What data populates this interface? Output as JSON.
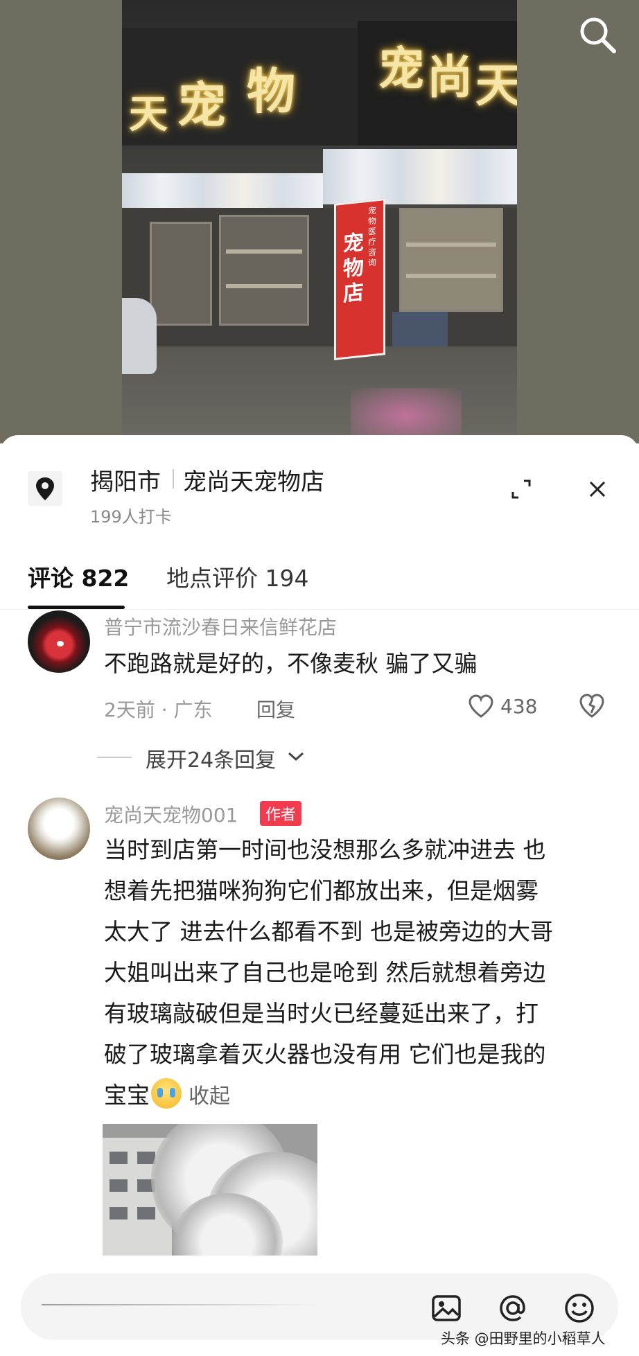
{
  "photo": {
    "sign_left_chars": [
      "天",
      "宠",
      "物"
    ],
    "sign_right_chars": [
      "宠",
      "尚",
      "天"
    ],
    "banner_big": "宠物店",
    "banner_small": "宠物医疗咨询"
  },
  "header": {
    "city": "揭阳市",
    "place_name": "宠尚天宠物店",
    "checkin_count": "199人打卡",
    "icons": [
      "location-pin-icon",
      "expand-icon",
      "close-icon",
      "search-icon"
    ]
  },
  "tabs": [
    {
      "label": "评论 822",
      "active": true
    },
    {
      "label": "地点评价 194",
      "active": false
    }
  ],
  "comments": [
    {
      "user": "普宁市流沙春日来信鲜花店",
      "text": "不跑路就是好的，不像麦秋 骗了又骗",
      "time_location": "2天前 · 广东",
      "reply_label": "回复",
      "likes": "438",
      "expand_replies": "展开24条回复"
    },
    {
      "user": "宠尚天宠物001",
      "badge": "作者",
      "lines": [
        "当时到店第一时间也没想那么多就冲进去 也",
        "想着先把猫咪狗狗它们都放出来，但是烟雾",
        "太大了 进去什么都看不到 也是被旁边的大哥",
        "大姐叫出来了自己也是呛到 然后就想着旁边",
        "有玻璃敲破但是当时火已经蔓延出来了，打",
        "破了玻璃拿着灭火器也没有用 它们也是我的",
        "宝宝"
      ],
      "collapse_label": "收起"
    }
  ],
  "input_bar": {
    "icons": [
      "image-icon",
      "at-icon",
      "emoji-icon"
    ]
  },
  "watermark": "头条 @田野里的小稻草人",
  "colors": {
    "author_badge": "#f23b4f",
    "text_primary": "#1a1a1a",
    "text_secondary": "#999999"
  }
}
